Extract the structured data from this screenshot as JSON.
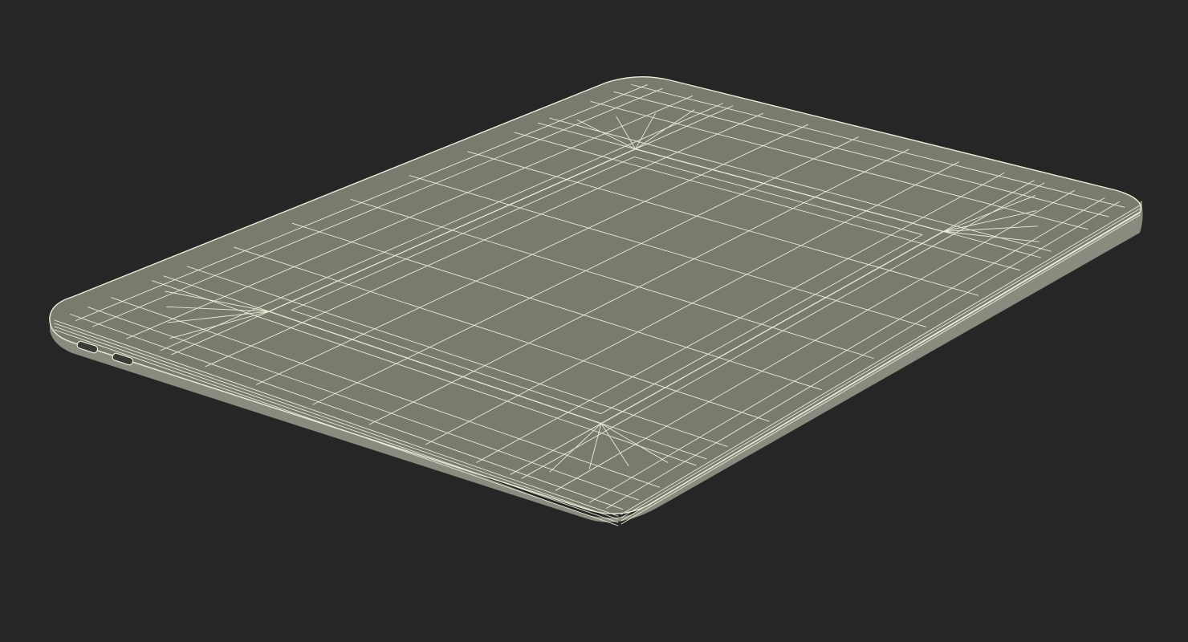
{
  "scene": {
    "background_color": "#262626",
    "surface_color": "#7a7b6f",
    "side_color": "#8a8b7f",
    "wire_color": "#ecebd8",
    "render_style": "wireframe-on-shaded",
    "subject": "laptop-lid-3d-model"
  }
}
